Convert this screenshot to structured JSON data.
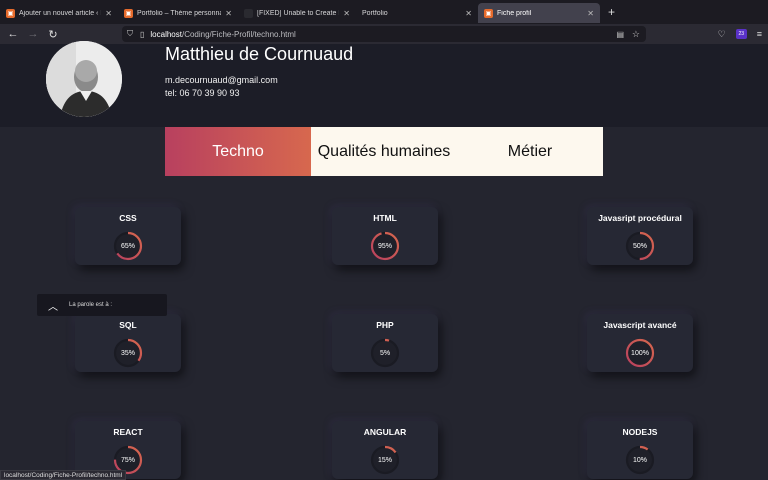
{
  "browser": {
    "tabs": [
      {
        "title": "Ajouter un nouvel article ‹ Portfolio",
        "active": false
      },
      {
        "title": "Portfolio – Thème personnalisé",
        "active": false
      },
      {
        "title": "[FIXED] Unable to Create Directory",
        "active": false
      },
      {
        "title": "Portfolio",
        "active": false
      },
      {
        "title": "Fiche profil",
        "active": true
      }
    ],
    "url_host": "localhost",
    "url_path": "/Coding/Fiche-Profil/techno.html",
    "extension_badge": "23",
    "status_url": "localhost/Coding/Fiche-Profil/techno.html"
  },
  "profile": {
    "name": "Matthieu de Cournuaud",
    "email": "m.decournuaud@gmail.com",
    "phone": "tel: 06 70 39 90 93"
  },
  "tabs": {
    "techno": "Techno",
    "qualites": "Qualités humaines",
    "metier": "Métier"
  },
  "skills": [
    {
      "label": "CSS",
      "percent": 65,
      "percent_text": "65%"
    },
    {
      "label": "HTML",
      "percent": 95,
      "percent_text": "95%"
    },
    {
      "label": "Javasript procédural",
      "percent": 50,
      "percent_text": "50%"
    },
    {
      "label": "SQL",
      "percent": 35,
      "percent_text": "35%"
    },
    {
      "label": "PHP",
      "percent": 5,
      "percent_text": "5%"
    },
    {
      "label": "Javascript avancé",
      "percent": 100,
      "percent_text": "100%"
    },
    {
      "label": "REACT",
      "percent": 75,
      "percent_text": "75%"
    },
    {
      "label": "ANGULAR",
      "percent": 15,
      "percent_text": "15%"
    },
    {
      "label": "NODEJS",
      "percent": 10,
      "percent_text": "10%"
    }
  ],
  "toast": {
    "message": "La parole est à :"
  },
  "colors": {
    "accent_start": "#b8405f",
    "accent_end": "#d7684e",
    "background": "#24252f",
    "tab_bg": "#fdf8ee"
  }
}
